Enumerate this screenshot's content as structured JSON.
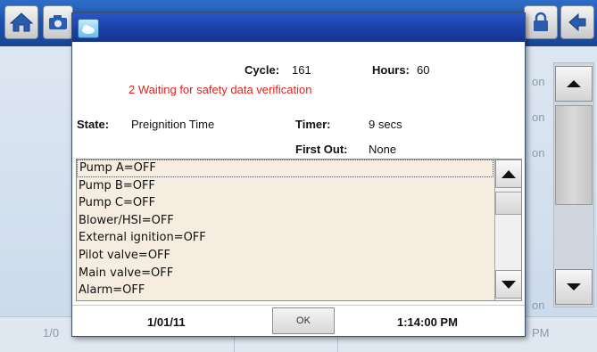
{
  "background": {
    "side_labels": [
      "on",
      "on",
      "on",
      "on"
    ],
    "bottom_left": "1/0",
    "bottom_right": "PM"
  },
  "dialog": {
    "cycle_label": "Cycle:",
    "cycle_value": "161",
    "hours_label": "Hours:",
    "hours_value": "60",
    "status_message": "2 Waiting for safety data verification",
    "state_label": "State:",
    "state_value": "Preignition Time",
    "timer_label": "Timer:",
    "timer_value": "9 secs",
    "first_out_label": "First Out:",
    "first_out_value": "None",
    "list_items": [
      "Pump A=OFF",
      "Pump B=OFF",
      "Pump C=OFF",
      "Blower/HSI=OFF",
      "External ignition=OFF",
      "Pilot valve=OFF",
      "Main valve=OFF",
      "Alarm=OFF"
    ],
    "date": "1/01/11",
    "ok_label": "OK",
    "time": "1:14:00 PM"
  },
  "colors": {
    "titlebar": "#1b3fa6",
    "status_text": "#e0241e",
    "list_background": "#f6ece0"
  }
}
